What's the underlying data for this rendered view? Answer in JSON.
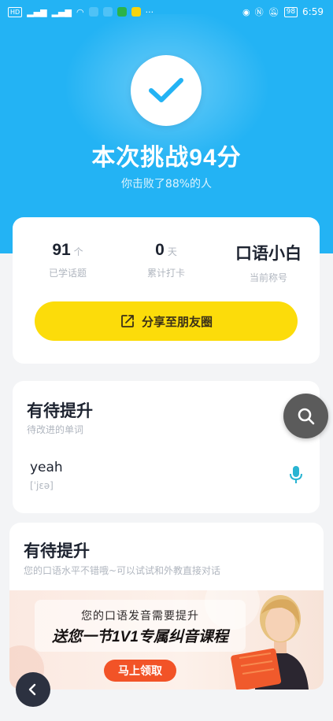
{
  "status_bar": {
    "left_items": [
      "HD",
      "4G",
      "46"
    ],
    "battery": "98",
    "time": "6:59"
  },
  "hero": {
    "icon": "checkmark-icon",
    "title": "本次挑战94分",
    "subtitle": "你击败了88%的人"
  },
  "stats": [
    {
      "value": "91",
      "unit": "个",
      "label": "已学话题"
    },
    {
      "value": "0",
      "unit": "天",
      "label": "累计打卡"
    },
    {
      "value": "口语小白",
      "unit": "",
      "label": "当前称号"
    }
  ],
  "share_button": {
    "label": "分享至朋友圈",
    "icon": "share-icon"
  },
  "words_section": {
    "title": "有待提升",
    "subtitle": "待改进的单词",
    "words": [
      {
        "word": "yeah",
        "phonetic": "[ˈjɛə]"
      }
    ]
  },
  "teacher_section": {
    "title": "有待提升",
    "subtitle": "您的口语水平不错哦~可以试试和外教直接对话",
    "banner": {
      "line1": "您的口语发音需要提升",
      "line2": "送您一节1V1专属纠音课程",
      "cta": "马上领取"
    }
  },
  "colors": {
    "hero_blue": "#23b3f4",
    "share_yellow": "#fcdc0a",
    "mic_teal": "#29b4d2",
    "cta_orange": "#f25327"
  },
  "icons": [
    "checkmark-icon",
    "share-icon",
    "microphone-icon",
    "search-icon",
    "back-arrow-icon"
  ]
}
